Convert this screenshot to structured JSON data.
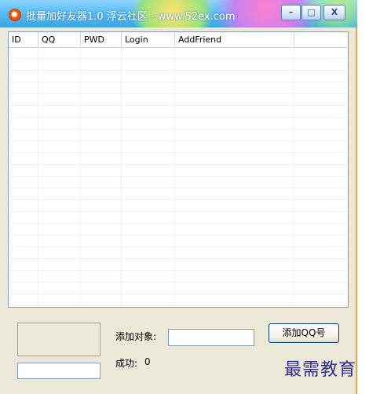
{
  "window": {
    "title": "批量加好友器1.0 浮云社区",
    "title_separator": " - ",
    "title_url": "www.52ex.com",
    "controls": {
      "minimize": "–",
      "maximize": "□",
      "close": "X"
    }
  },
  "listview": {
    "columns": [
      "ID",
      "QQ",
      "PWD",
      "Login",
      "AddFriend"
    ],
    "rows": []
  },
  "form": {
    "target_label": "添加对象:",
    "target_value": "",
    "add_button": "添加QQ号",
    "success_label": "成功:",
    "success_count": "0",
    "bottom_value": ""
  },
  "watermark": "最需教育",
  "colors": {
    "title_bar": "#5bbcf2",
    "window_bg": "#ece9d8",
    "watermark": "#2b2f8f"
  }
}
